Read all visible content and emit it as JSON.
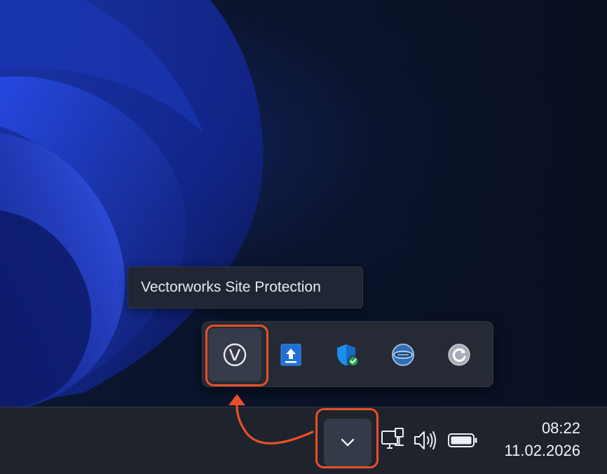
{
  "tooltip": {
    "text": "Vectorworks Site Protection"
  },
  "tray_flyout": {
    "icons": [
      {
        "icon": "vectorworks-icon",
        "hovered": true
      },
      {
        "icon": "upload-icon",
        "hovered": false
      },
      {
        "icon": "security-shield-icon",
        "hovered": false
      },
      {
        "icon": "teamviewer-style-round-icon",
        "hovered": false
      },
      {
        "icon": "refresh-sync-icon",
        "hovered": false
      }
    ]
  },
  "taskbar": {
    "overflow_button_icon": "chevron-down-icon",
    "system_icons": [
      "network-icon",
      "volume-icon",
      "battery-icon"
    ],
    "clock": {
      "time": "08:22",
      "date": "11.02.2026"
    }
  },
  "annotation": {
    "highlight_color": "#e8502a"
  },
  "colors": {
    "taskbar_bg": "#1f232c",
    "flyout_bg": "#252a35",
    "tooltip_bg": "#202633"
  }
}
